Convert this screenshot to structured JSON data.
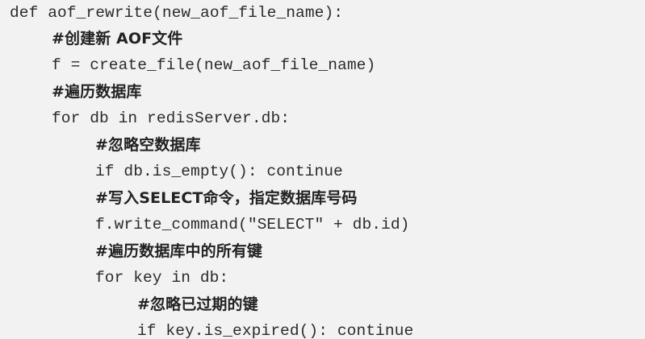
{
  "code": {
    "lines": [
      "def aof_rewrite(new_aof_file_name):",
      "#创建新 AOF文件",
      "f = create_file(new_aof_file_name)",
      "#遍历数据库",
      "for db in redisServer.db:",
      "#忽略空数据库",
      "if db.is_empty(): continue",
      "#写入SELECT命令，指定数据库号码",
      "f.write_command(\"SELECT\" + db.id)",
      "#遍历数据库中的所有键",
      "for key in db:",
      "#忽略已过期的键",
      "if key.is_expired(): continue"
    ]
  }
}
